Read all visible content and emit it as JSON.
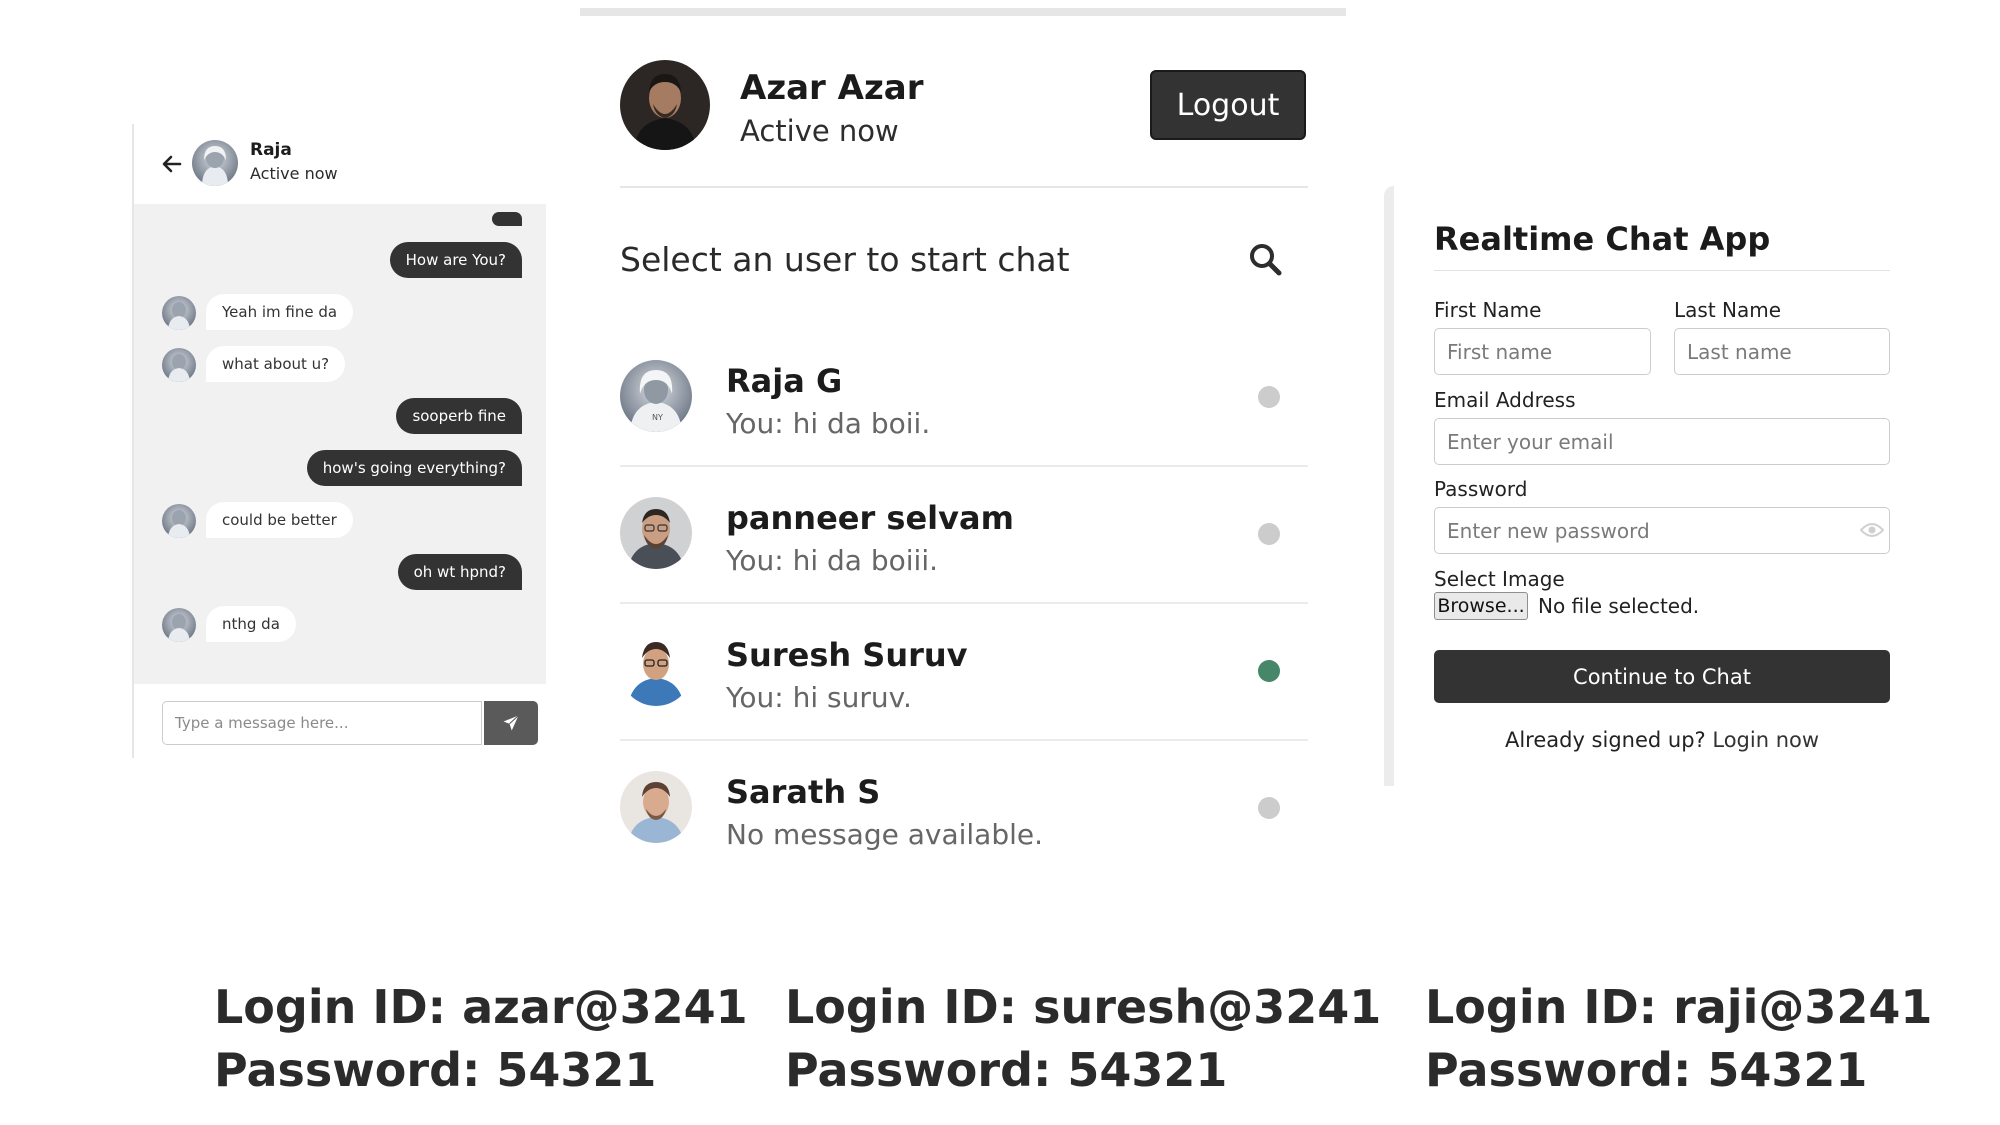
{
  "chat": {
    "contact_name": "Raja",
    "contact_status": "Active now",
    "messages": [
      {
        "dir": "out",
        "text": "How are You?"
      },
      {
        "dir": "in",
        "text": "Yeah im fine da"
      },
      {
        "dir": "in",
        "text": "what about u?"
      },
      {
        "dir": "out",
        "text": "sooperb fine"
      },
      {
        "dir": "out",
        "text": "how's going everything?"
      },
      {
        "dir": "in",
        "text": "could be better"
      },
      {
        "dir": "out",
        "text": "oh wt hpnd?"
      },
      {
        "dir": "in",
        "text": "nthg da"
      }
    ],
    "input_placeholder": "Type a message here..."
  },
  "users": {
    "me_name": "Azar Azar",
    "me_status": "Active now",
    "logout_label": "Logout",
    "search_label": "Select an user to start chat",
    "list": [
      {
        "name": "Raja G",
        "last_message": "You: hi da boii.",
        "online": false
      },
      {
        "name": "panneer selvam",
        "last_message": "You: hi da boiii.",
        "online": false
      },
      {
        "name": "Suresh Suruv",
        "last_message": "You: hi suruv.",
        "online": true
      },
      {
        "name": "Sarath S",
        "last_message": "No message available.",
        "online": false
      }
    ],
    "online_color": "#468669",
    "offline_color": "#cccccc"
  },
  "signup": {
    "title": "Realtime Chat App",
    "first_name_label": "First Name",
    "first_name_placeholder": "First name",
    "last_name_label": "Last Name",
    "last_name_placeholder": "Last name",
    "email_label": "Email Address",
    "email_placeholder": "Enter your email",
    "password_label": "Password",
    "password_placeholder": "Enter new password",
    "image_label": "Select Image",
    "browse_label": "Browse...",
    "file_status": "No file selected.",
    "submit_label": "Continue to Chat",
    "signin_prompt": "Already signed up?",
    "signin_link": "Login now"
  },
  "credentials": [
    {
      "login": "Login ID: azar@3241",
      "password": "Password: 54321"
    },
    {
      "login": "Login ID: suresh@3241",
      "password": "Password: 54321"
    },
    {
      "login": "Login ID: raji@3241",
      "password": "Password: 54321"
    }
  ]
}
